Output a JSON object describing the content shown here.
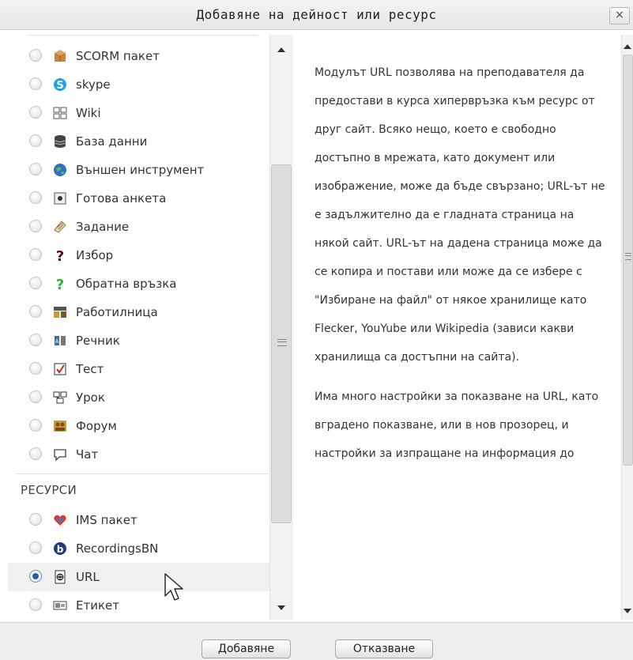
{
  "dialog": {
    "title": "Добавяне на дейност или ресурс",
    "close_label": "×"
  },
  "activities": [
    {
      "label": "SCORM пакет",
      "icon": "scorm-package-icon",
      "selected": false
    },
    {
      "label": "skype",
      "icon": "skype-icon",
      "selected": false
    },
    {
      "label": "Wiki",
      "icon": "wiki-icon",
      "selected": false
    },
    {
      "label": "База данни",
      "icon": "database-icon",
      "selected": false
    },
    {
      "label": "Външен инструмент",
      "icon": "external-tool-icon",
      "selected": false
    },
    {
      "label": "Готова анкета",
      "icon": "survey-icon",
      "selected": false
    },
    {
      "label": "Задание",
      "icon": "assignment-icon",
      "selected": false
    },
    {
      "label": "Избор",
      "icon": "choice-icon",
      "selected": false
    },
    {
      "label": "Обратна връзка",
      "icon": "feedback-icon",
      "selected": false
    },
    {
      "label": "Работилница",
      "icon": "workshop-icon",
      "selected": false
    },
    {
      "label": "Речник",
      "icon": "glossary-icon",
      "selected": false
    },
    {
      "label": "Тест",
      "icon": "quiz-icon",
      "selected": false
    },
    {
      "label": "Урок",
      "icon": "lesson-icon",
      "selected": false
    },
    {
      "label": "Форум",
      "icon": "forum-icon",
      "selected": false
    },
    {
      "label": "Чат",
      "icon": "chat-icon",
      "selected": false
    }
  ],
  "resources_heading": "РЕСУРСИ",
  "resources": [
    {
      "label": "IMS пакет",
      "icon": "ims-package-icon",
      "selected": false
    },
    {
      "label": "RecordingsBN",
      "icon": "recordings-icon",
      "selected": false
    },
    {
      "label": "URL",
      "icon": "url-icon",
      "selected": true
    },
    {
      "label": "Етикет",
      "icon": "label-icon",
      "selected": false
    }
  ],
  "description": {
    "paragraph1": "Модулът URL позволява на преподавателя да предостави в курса хипервръзка към ресурс от друг сайт. Всяко нещо, което е свободно достъпно в мрежата, като документ или изображение, може да бъде свързано; URL-ът не е задължително да е гладната страница на някой сайт. URL-ът на дадена страница може да се копира и постави или може да се избере с \"Избиране на файл\" от някое хранилище като Flecker, YouYube или Wikipedia (зависи какви хранилища са достъпни на сайта).",
    "paragraph2": "Има много настройки за показване на URL, като вградено показване, или в нов прозорец, и настройки за изпращане на информация до"
  },
  "buttons": {
    "add_label": "Добавяне",
    "cancel_label": "Отказване"
  },
  "colors": {
    "selected_radio": "#2a5fa3",
    "selected_row": "#f0f0f0"
  }
}
